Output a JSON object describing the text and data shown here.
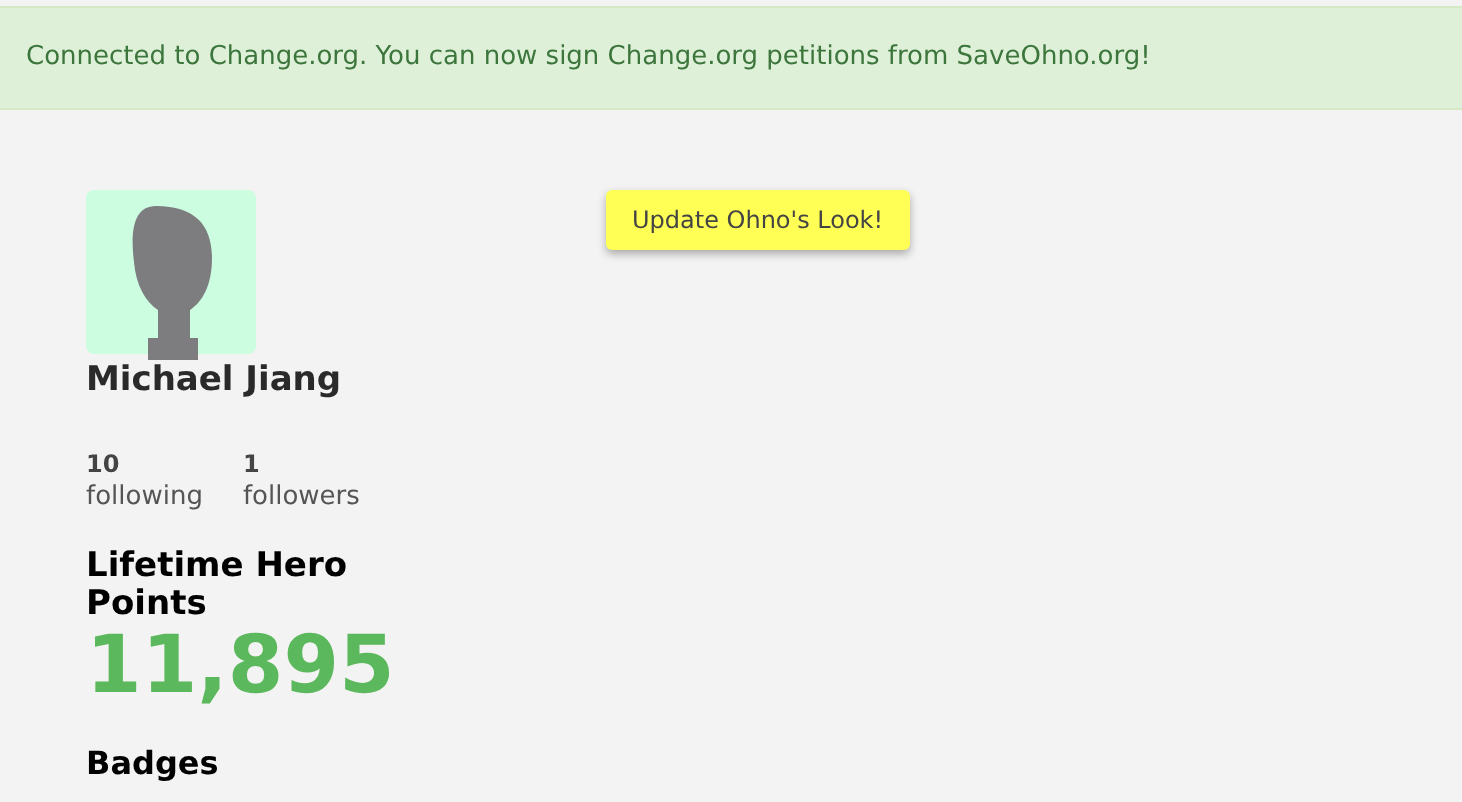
{
  "alert": {
    "text": "Connected to Change.org. You can now sign Change.org petitions from SaveOhno.org!"
  },
  "profile": {
    "name": "Michael Jiang",
    "stats": [
      {
        "count": "10",
        "label": "following"
      },
      {
        "count": "1",
        "label": "followers"
      }
    ],
    "points_heading": "Lifetime Hero Points",
    "points": "11,895",
    "badges_heading": "Badges"
  },
  "update_button": "Update Ohno's Look!"
}
